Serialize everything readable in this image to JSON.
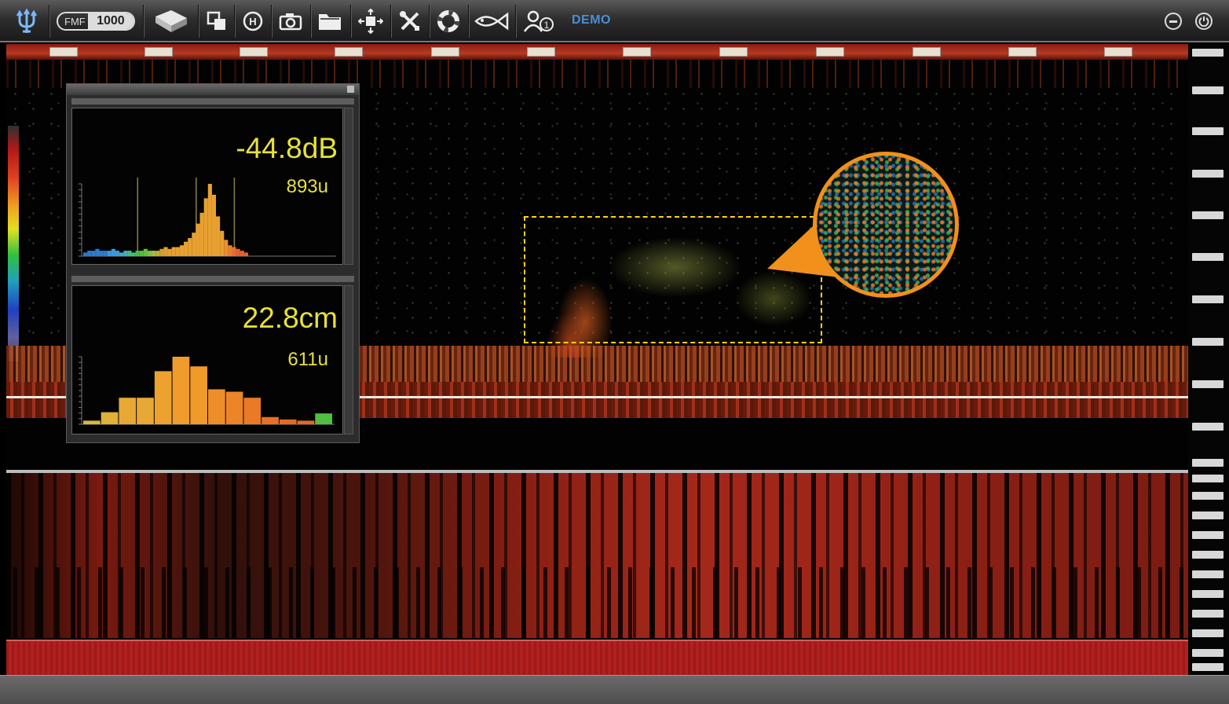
{
  "toolbar": {
    "model_prefix": "FMF",
    "model_number": "1000",
    "mode_label": "DEMO",
    "icons": [
      "trident-logo-icon",
      "model-badge",
      "echosounder-3d-icon",
      "window-layers-icon",
      "h-circle-icon",
      "camera-icon",
      "folder-icon",
      "move-crosshair-icon",
      "tools-icon",
      "lifebuoy-icon",
      "fish-icon",
      "user-1-icon",
      "minimize-icon",
      "power-icon"
    ]
  },
  "panel": {
    "strength_value": "-44.8dB",
    "strength_count": "893u",
    "length_value": "22.8cm",
    "length_count": "611u"
  },
  "chart_data": [
    {
      "type": "bar",
      "values": [
        2,
        3,
        3,
        4,
        3,
        3,
        3,
        4,
        3,
        2,
        3,
        3,
        2,
        3,
        3,
        4,
        3,
        3,
        3,
        4,
        5,
        4,
        5,
        5,
        6,
        8,
        10,
        13,
        18,
        24,
        32,
        40,
        34,
        22,
        14,
        9,
        6,
        5,
        4,
        3,
        2
      ],
      "colors": [
        "#2a7ad0",
        "#2a7ad0",
        "#2a7ad0",
        "#2a7ad0",
        "#2a7ad0",
        "#2a7ad0",
        "#3a9ae0",
        "#3a9ae0",
        "#3a9ae0",
        "#40b0c0",
        "#40b0c0",
        "#40c080",
        "#40c080",
        "#40c040",
        "#50c040",
        "#60c040",
        "#80c040",
        "#a0c040",
        "#c0b030",
        "#d0a030",
        "#e0a030",
        "#e8a030",
        "#e8a030",
        "#e8a030",
        "#e8a030",
        "#e8a030",
        "#e8a030",
        "#e8a030",
        "#e8a030",
        "#e8a030",
        "#e8a030",
        "#e8a030",
        "#e8a030",
        "#e8a030",
        "#e8a030",
        "#e89030",
        "#e88030",
        "#e87030",
        "#e86030",
        "#e86030",
        "#e86030"
      ]
    },
    {
      "type": "bar",
      "values": [
        3,
        10,
        22,
        22,
        44,
        56,
        48,
        29,
        27,
        22,
        6,
        4,
        3,
        9
      ],
      "colors": [
        "#d8b838",
        "#e0b038",
        "#e8a836",
        "#e8a836",
        "#eda230",
        "#f09c2c",
        "#f09a2c",
        "#ee8e2a",
        "#ec8428",
        "#ea7a26",
        "#e87024",
        "#e66a22",
        "#e46a22",
        "#50c040"
      ]
    }
  ]
}
